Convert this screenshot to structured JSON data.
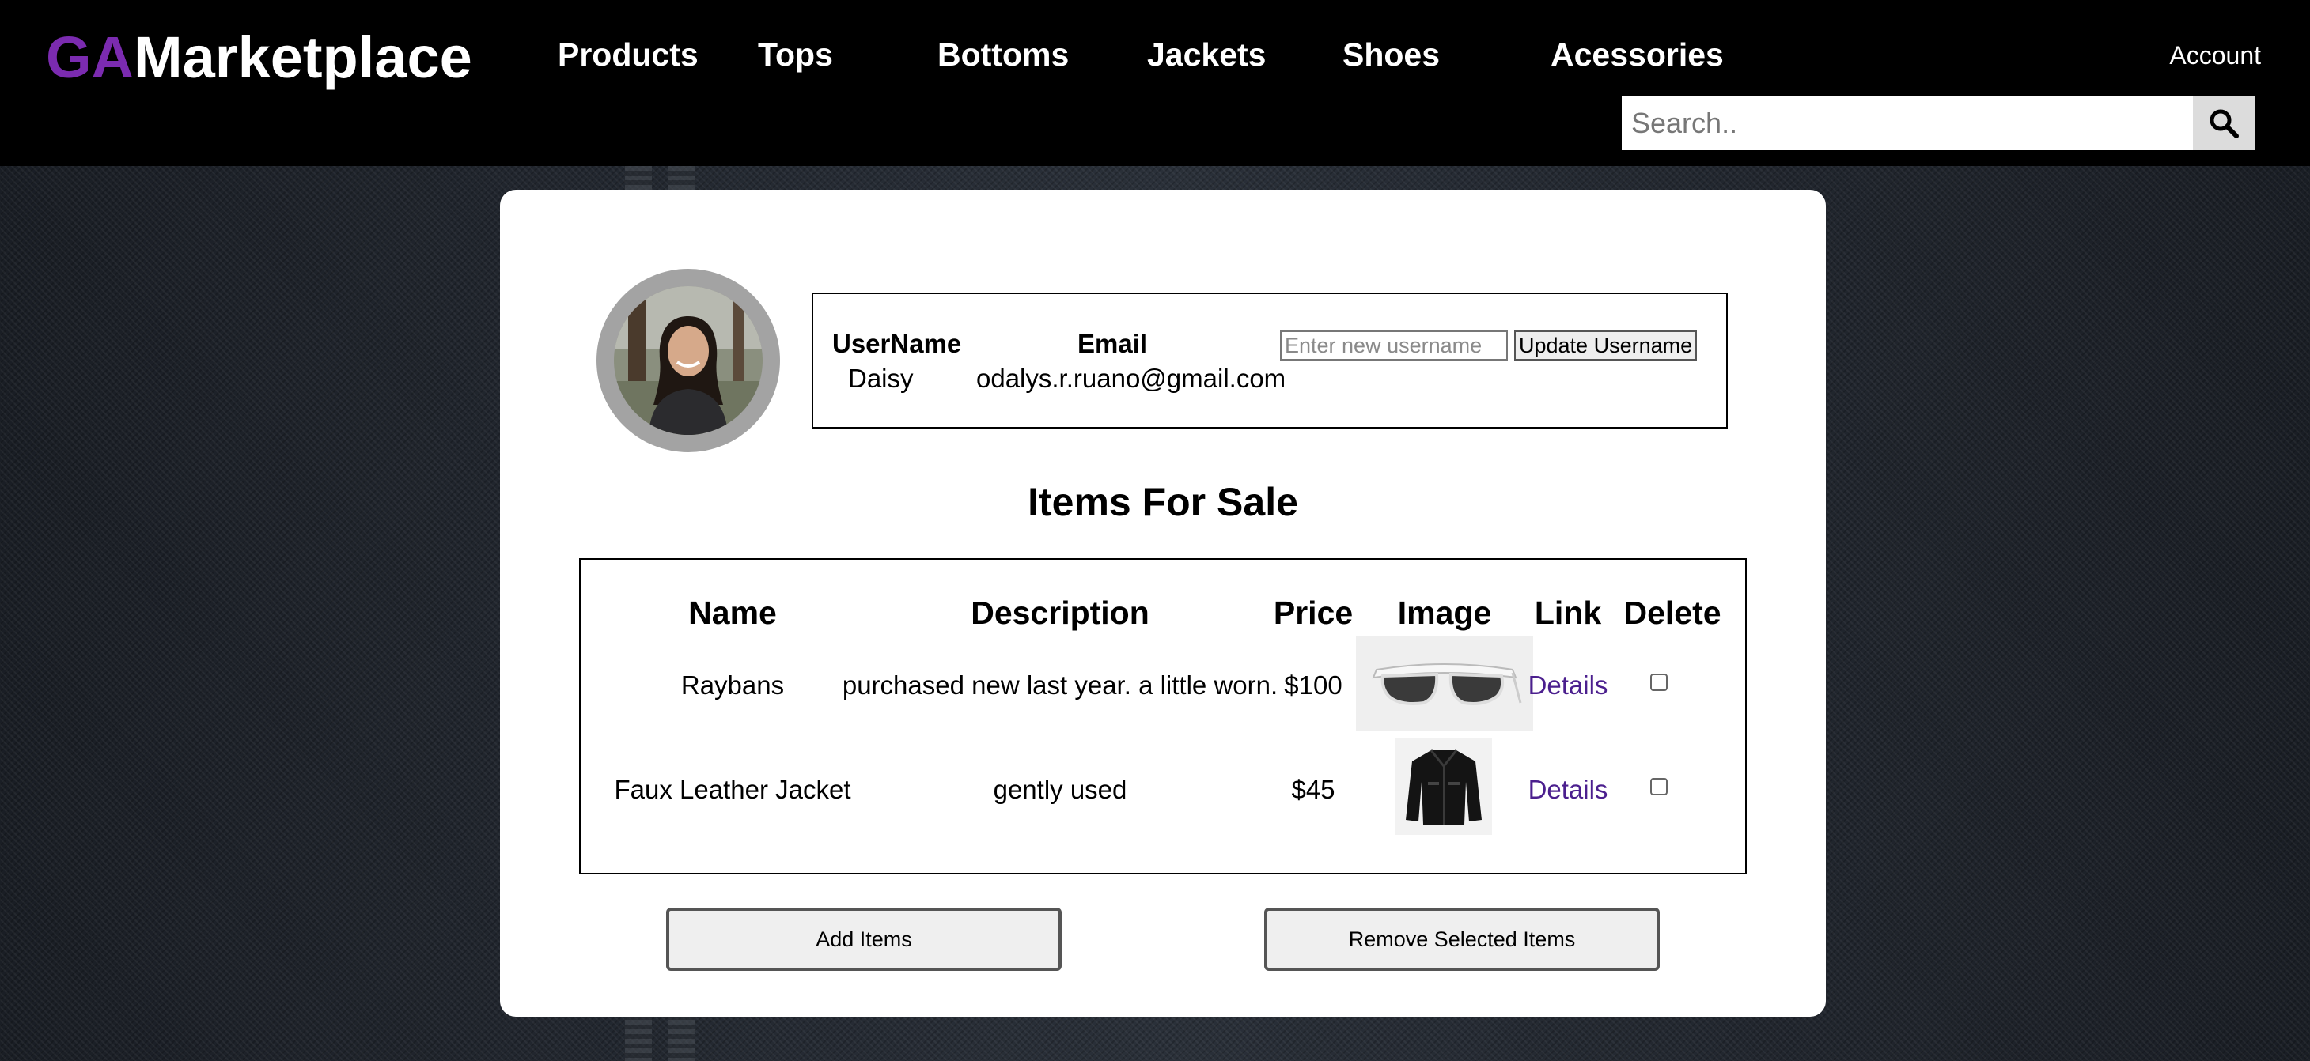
{
  "brand": {
    "prefix": "GA",
    "name": "Marketplace"
  },
  "nav": {
    "products": "Products",
    "tops": "Tops",
    "bottoms": "Bottoms",
    "jackets": "Jackets",
    "shoes": "Shoes",
    "accessories": "Acessories",
    "account": "Account"
  },
  "search": {
    "placeholder": "Search.."
  },
  "profile": {
    "username_label": "UserName",
    "email_label": "Email",
    "username": "Daisy",
    "email": "odalys.r.ruano@gmail.com",
    "new_username_placeholder": "Enter new username",
    "update_button": "Update Username"
  },
  "items": {
    "title": "Items For Sale",
    "headers": {
      "name": "Name",
      "description": "Description",
      "price": "Price",
      "image": "Image",
      "link": "Link",
      "delete": "Delete"
    },
    "rows": [
      {
        "name": "Raybans",
        "description": "purchased new last year. a little worn.",
        "price": "$100",
        "image": "sunglasses",
        "link": "Details"
      },
      {
        "name": "Faux Leather Jacket",
        "description": "gently used",
        "price": "$45",
        "image": "jacket",
        "link": "Details"
      }
    ]
  },
  "actions": {
    "add": "Add Items",
    "remove": "Remove Selected Items"
  },
  "colors": {
    "brand_accent": "#7b2bb0",
    "link": "#4b1f8e",
    "header_bg": "#000000"
  }
}
